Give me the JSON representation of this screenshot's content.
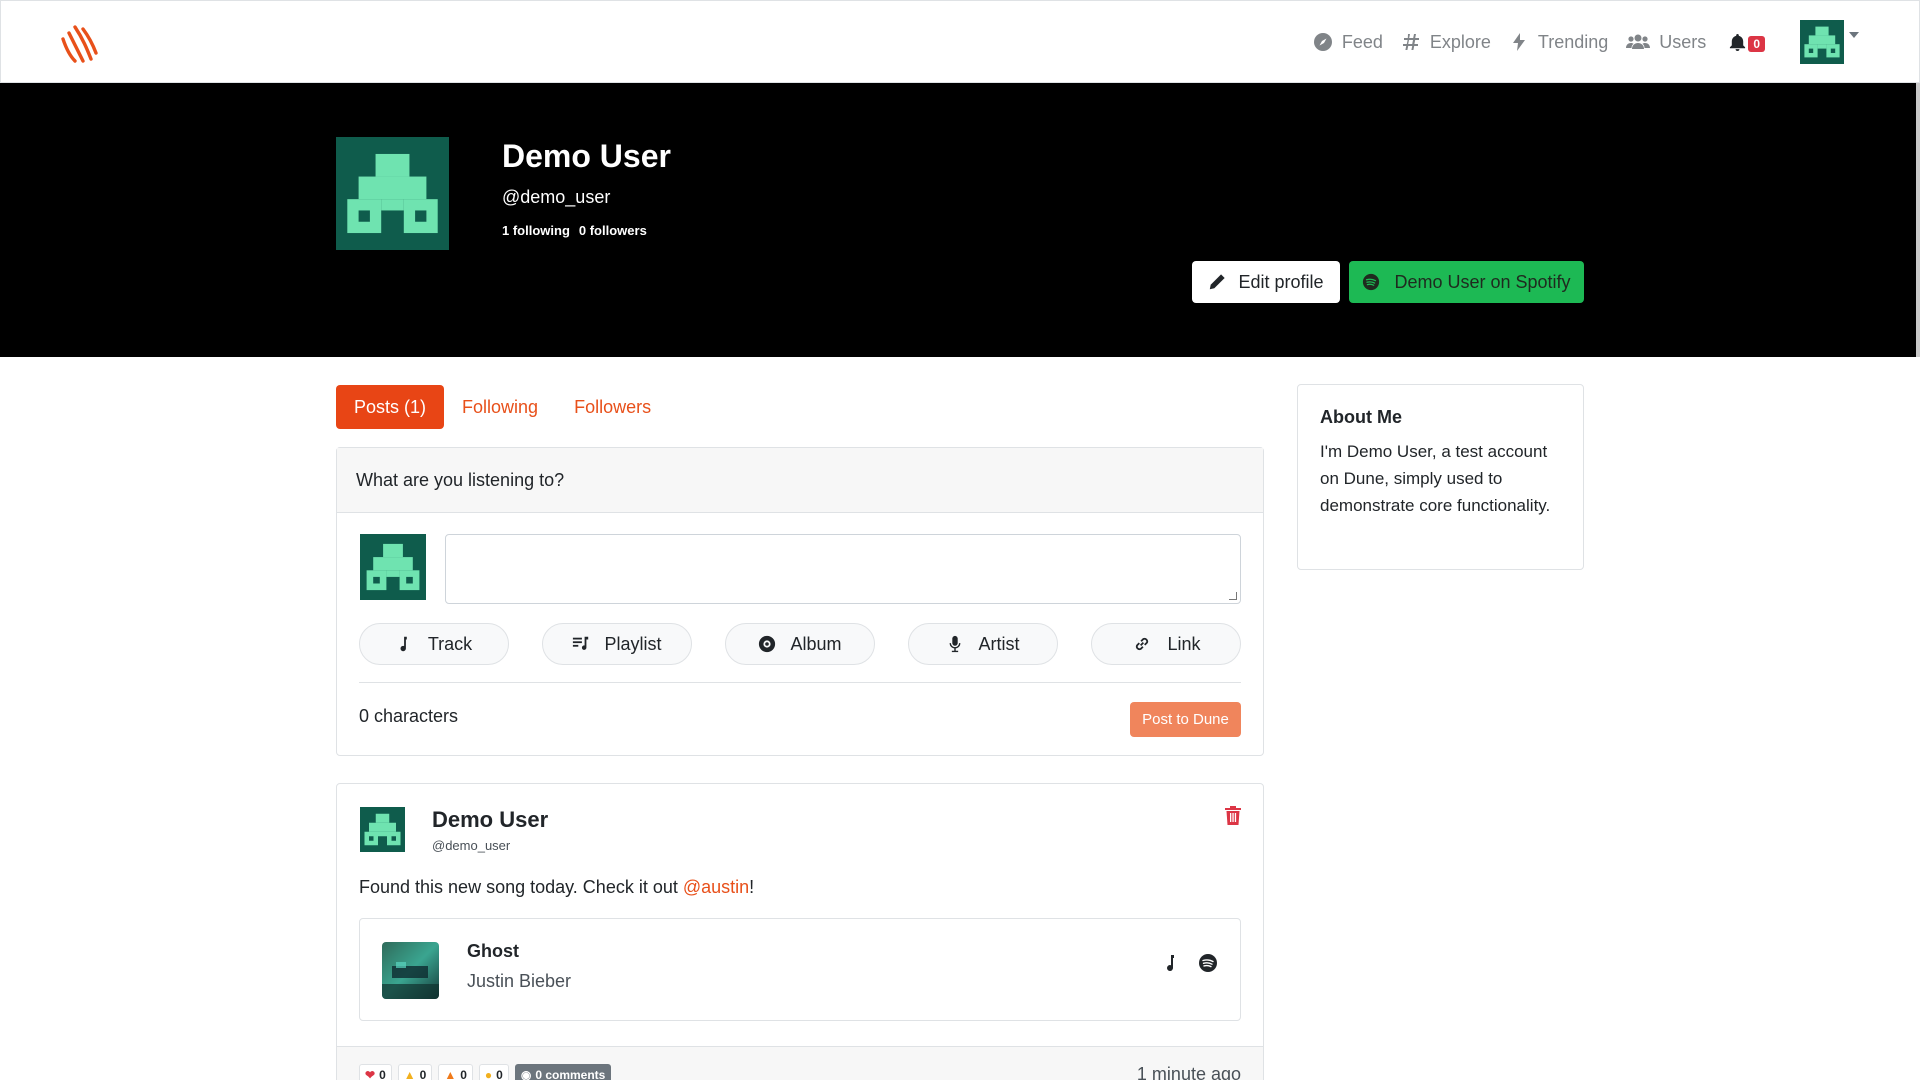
{
  "nav": {
    "feed": "Feed",
    "explore": "Explore",
    "trending": "Trending",
    "users": "Users",
    "notification_count": "0"
  },
  "profile": {
    "name": "Demo User",
    "handle": "@demo_user",
    "following": "1 following",
    "followers": "0 followers",
    "edit_label": "Edit profile",
    "spotify_label": "Demo User on Spotify"
  },
  "tabs": [
    {
      "label": "Posts (1)",
      "active": true
    },
    {
      "label": "Following",
      "active": false
    },
    {
      "label": "Followers",
      "active": false
    }
  ],
  "composer": {
    "prompt": "What are you listening to?",
    "textarea_value": "",
    "buttons": [
      "Track",
      "Playlist",
      "Album",
      "Artist",
      "Link"
    ],
    "char_count": "0 characters",
    "post_label": "Post to Dune"
  },
  "post": {
    "author": "Demo User",
    "handle": "@demo_user",
    "text_before": "Found this new song today. Check it out ",
    "mention": "@austin",
    "text_after": "!",
    "track": {
      "title": "Ghost",
      "artist": "Justin Bieber"
    },
    "reactions": [
      {
        "icon": "heart-icon",
        "count": "0"
      },
      {
        "icon": "thumbs-up-icon",
        "count": "0"
      },
      {
        "icon": "fire-icon",
        "count": "0"
      },
      {
        "icon": "angry-face-icon",
        "count": "0"
      }
    ],
    "comments_label": "0 comments",
    "timestamp": "1 minute ago"
  },
  "about": {
    "title": "About Me",
    "body": "I'm Demo User, a test account on Dune, simply used to demonstrate core functionality."
  },
  "colors": {
    "accent": "#e84515",
    "spotify": "#1db954",
    "avatar_bg": "#0f5c4c",
    "avatar_fg": "#6fe3b0",
    "danger": "#dc3545"
  }
}
